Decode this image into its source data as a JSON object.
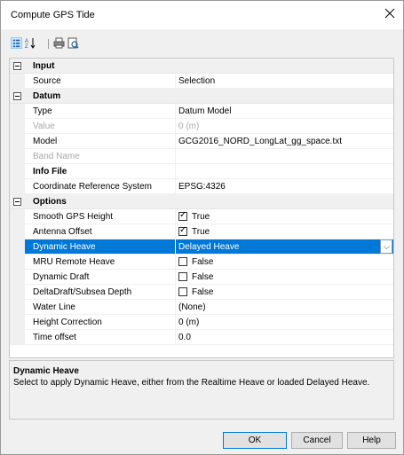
{
  "window": {
    "title": "Compute GPS Tide"
  },
  "toolbar": {
    "icons": [
      "categorized-icon",
      "sort-alpha-icon",
      "print-icon",
      "preview-icon"
    ]
  },
  "grid": {
    "categories": {
      "input": "Input",
      "datum": "Datum",
      "options": "Options"
    },
    "rows": {
      "source": {
        "name": "Source",
        "value": "Selection"
      },
      "type": {
        "name": "Type",
        "value": "Datum Model"
      },
      "value": {
        "name": "Value",
        "value": "0 (m)"
      },
      "model": {
        "name": "Model",
        "value": "GCG2016_NORD_LongLat_gg_space.txt"
      },
      "band_name": {
        "name": "Band Name",
        "value": ""
      },
      "info_file": {
        "name": "Info File",
        "value": ""
      },
      "crs": {
        "name": "Coordinate Reference System",
        "value": "EPSG:4326"
      },
      "smooth_gps": {
        "name": "Smooth GPS Height",
        "value": "True",
        "checked": true
      },
      "antenna_offset": {
        "name": "Antenna Offset",
        "value": "True",
        "checked": true
      },
      "dynamic_heave": {
        "name": "Dynamic Heave",
        "value": "Delayed Heave"
      },
      "mru_remote": {
        "name": "MRU Remote Heave",
        "value": "False",
        "checked": false
      },
      "dynamic_draft": {
        "name": "Dynamic Draft",
        "value": "False",
        "checked": false
      },
      "deltadraft": {
        "name": "DeltaDraft/Subsea Depth",
        "value": "False",
        "checked": false
      },
      "water_line": {
        "name": "Water Line",
        "value": "(None)"
      },
      "height_correction": {
        "name": "Height Correction",
        "value": "0 (m)"
      },
      "time_offset": {
        "name": "Time offset",
        "value": "0.0"
      }
    },
    "selection_color": "#0078d7"
  },
  "description": {
    "title": "Dynamic Heave",
    "text": "Select to apply Dynamic Heave, either from the Realtime Heave or loaded Delayed Heave."
  },
  "buttons": {
    "ok": "OK",
    "cancel": "Cancel",
    "help": "Help"
  }
}
